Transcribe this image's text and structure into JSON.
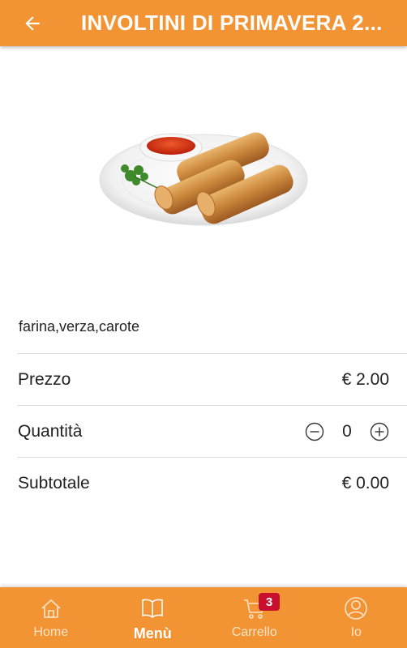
{
  "header": {
    "title": "INVOLTINI DI PRIMAVERA 2...",
    "back_icon": "arrow-left-icon"
  },
  "product": {
    "image": "spring-rolls-plate-photo",
    "description": "farina,verza,carote"
  },
  "details": {
    "price_label": "Prezzo",
    "price_value": "€ 2.00",
    "quantity_label": "Quantità",
    "quantity_value": "0",
    "subtotal_label": "Subtotale",
    "subtotal_value": "€ 0.00"
  },
  "nav": {
    "items": [
      {
        "label": "Home",
        "icon": "home-icon",
        "active": false
      },
      {
        "label": "Menù",
        "icon": "book-icon",
        "active": true
      },
      {
        "label": "Carrello",
        "icon": "cart-icon",
        "active": false,
        "badge": "3"
      },
      {
        "label": "Io",
        "icon": "user-icon",
        "active": false
      }
    ]
  },
  "colors": {
    "accent": "#F39434",
    "badge": "#C8102E"
  }
}
